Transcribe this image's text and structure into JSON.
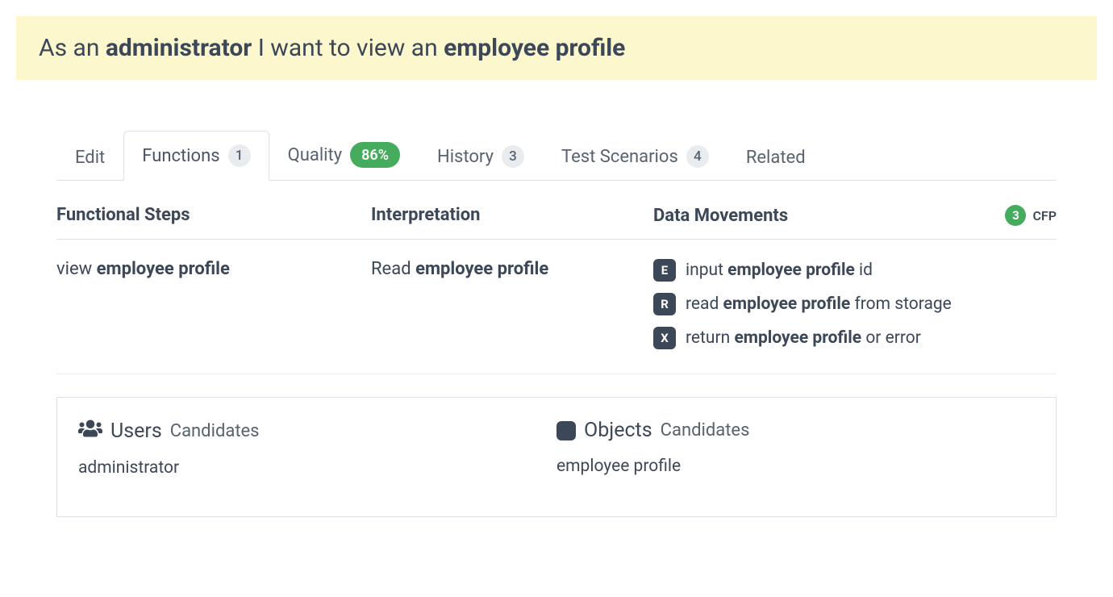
{
  "banner": {
    "prefix": "As an ",
    "role": "administrator",
    "mid": " I want to view an ",
    "object": "employee profile"
  },
  "tabs": {
    "edit": "Edit",
    "functions": {
      "label": "Functions",
      "count": "1"
    },
    "quality": {
      "label": "Quality",
      "percent": "86%"
    },
    "history": {
      "label": "History",
      "count": "3"
    },
    "test": {
      "label": "Test Scenarios",
      "count": "4"
    },
    "related": "Related"
  },
  "columns_header": ": {",
  "headers": {
    "steps": "Functional Steps",
    "interpretation": "Interpretation",
    "data_movements": "Data Movements",
    "cfp_count": "3",
    "cfp_label": "CFP"
  },
  "row": {
    "step_prefix": "view ",
    "step_bold": "employee profile",
    "interp_prefix": "Read ",
    "interp_bold": "employee profile",
    "dm": [
      {
        "tag": "E",
        "pre": "input ",
        "bold": "employee profile",
        "post": " id"
      },
      {
        "tag": "R",
        "pre": "read ",
        "bold": "employee profile",
        "post": " from storage"
      },
      {
        "tag": "X",
        "pre": "return ",
        "bold": "employee profile",
        "post": " or error"
      }
    ]
  },
  "candidates": {
    "users_title": "Users",
    "users_sub": "Candidates",
    "users_value": "administrator",
    "objects_title": "Objects",
    "objects_sub": "Candidates",
    "objects_value": "employee profile"
  }
}
